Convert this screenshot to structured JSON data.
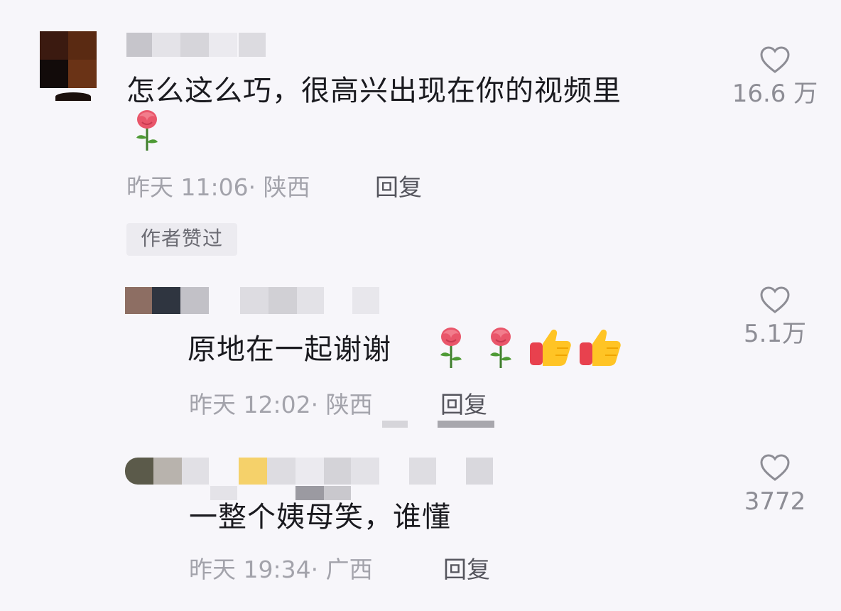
{
  "comments": [
    {
      "text": "怎么这么巧，很高兴出现在你的视频里",
      "time_location": "昨天 11:06· 陕西",
      "reply_label": "回复",
      "likes": "16.6 万",
      "badge": "作者赞过",
      "emojis": [
        "rose"
      ]
    },
    {
      "text": "原地在一起谢谢",
      "time_location": "昨天 12:02· 陕西",
      "reply_label": "回复",
      "likes": "5.1万",
      "emojis": [
        "rose",
        "rose",
        "thumbs-up",
        "thumbs-up"
      ]
    },
    {
      "text": "一整个姨母笑，谁懂",
      "time_location": "昨天 19:34· 广西",
      "reply_label": "回复",
      "likes": "3772",
      "emojis": []
    }
  ],
  "colors": {
    "background": "#f7f6fa",
    "text": "#1a1a1f",
    "meta": "#a3a3ab",
    "like_icon": "#8d8d95"
  }
}
